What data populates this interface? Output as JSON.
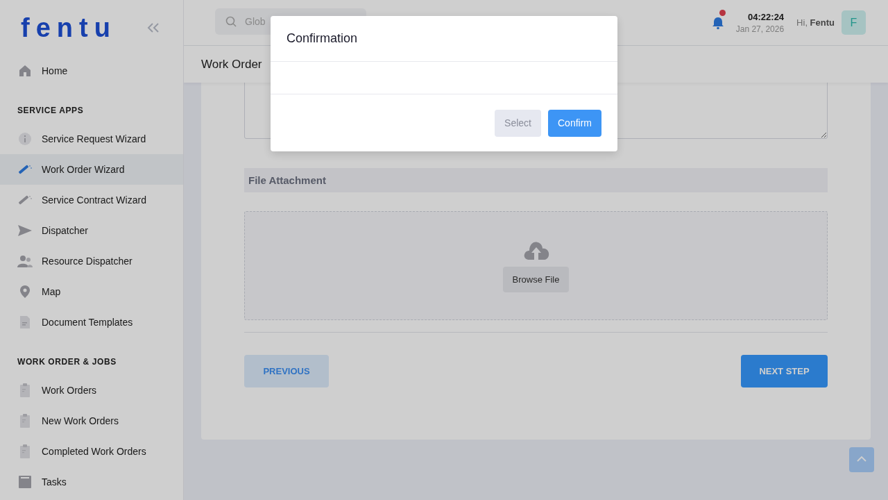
{
  "sidebar": {
    "logo": "fentu",
    "sections": [
      {
        "items": [
          {
            "label": "Home",
            "selected": false
          }
        ]
      },
      {
        "title": "SERVICE APPS",
        "items": [
          {
            "label": "Service Request Wizard",
            "selected": false
          },
          {
            "label": "Work Order Wizard",
            "selected": true
          },
          {
            "label": "Service Contract Wizard",
            "selected": false
          },
          {
            "label": "Dispatcher",
            "selected": false
          },
          {
            "label": "Resource Dispatcher",
            "selected": false
          },
          {
            "label": "Map",
            "selected": false
          },
          {
            "label": "Document Templates",
            "selected": false
          }
        ]
      },
      {
        "title": "WORK ORDER & JOBS",
        "items": [
          {
            "label": "Work Orders",
            "selected": false
          },
          {
            "label": "New Work Orders",
            "selected": false
          },
          {
            "label": "Completed Work Orders",
            "selected": false
          },
          {
            "label": "Tasks",
            "selected": false
          }
        ]
      }
    ]
  },
  "header": {
    "search": {
      "placeholder": "Glob"
    },
    "time": "04:22:24",
    "date": "Jan 27, 2026",
    "greeting": "Hi, **Fentu**",
    "avatar": "F"
  },
  "page": {
    "title": "Work Order",
    "section_title": "File Attachment",
    "browse_button": "Browse File",
    "previous_button": "PREVIOUS",
    "next_button": "NEXT STEP"
  },
  "modal": {
    "title": "Confirmation",
    "buttons": [
      {
        "label": "Select",
        "kind": "secondary"
      },
      {
        "label": "Confirm",
        "kind": "primary"
      }
    ]
  }
}
